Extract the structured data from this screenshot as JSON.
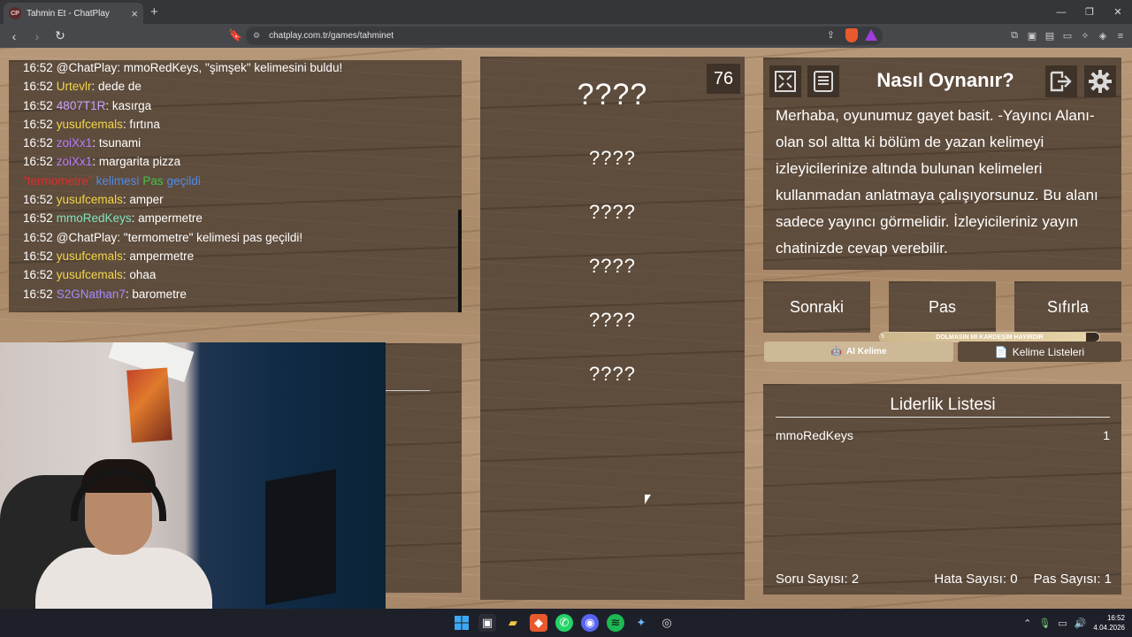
{
  "browser": {
    "tab_title": "Tahmin Et - ChatPlay",
    "tab_favicon_text": "CP",
    "url": "chatplay.com.tr/games/tahminet"
  },
  "chat": {
    "messages": [
      {
        "time": "16:52",
        "user": "@ChatPlay",
        "user_color": "#ffffff",
        "text": ": mmoRedKeys, \"şimşek\" kelimesini buldu!"
      },
      {
        "time": "16:52",
        "user": "Urtevlr",
        "user_color": "#f2d54b",
        "text": ": dede de"
      },
      {
        "time": "16:52",
        "user": "4807T1R",
        "user_color": "#c9a3ff",
        "text": ": kasırga"
      },
      {
        "time": "16:52",
        "user": "yusufcemals",
        "user_color": "#f2d54b",
        "text": ": fırtına"
      },
      {
        "time": "16:52",
        "user": "zoiXx1",
        "user_color": "#b77cff",
        "text": ": tsunami"
      },
      {
        "time": "16:52",
        "user": "zoiXx1",
        "user_color": "#b77cff",
        "text": ": margarita pizza"
      },
      {
        "time": "",
        "user": "",
        "user_color": "#ffffff",
        "text": "",
        "system": true
      },
      {
        "time": "16:52",
        "user": "yusufcemals",
        "user_color": "#f2d54b",
        "text": ": amper"
      },
      {
        "time": "16:52",
        "user": "mmoRedKeys",
        "user_color": "#7fe3c0",
        "text": ": ampermetre"
      },
      {
        "time": "16:52",
        "user": "@ChatPlay",
        "user_color": "#ffffff",
        "text": ": \"termometre\" kelimesi pas geçildi!"
      },
      {
        "time": "16:52",
        "user": "yusufcemals",
        "user_color": "#f2d54b",
        "text": ": ampermetre"
      },
      {
        "time": "16:52",
        "user": "yusufcemals",
        "user_color": "#f2d54b",
        "text": ": ohaa"
      },
      {
        "time": "16:52",
        "user": "S2GNathan7",
        "user_color": "#a48bff",
        "text": ": barometre"
      }
    ],
    "system_line": {
      "word": "\"termometre\"",
      "word_color": "#d8322e",
      "kelimesi": "kelimesi",
      "kelimesi_color": "#4f8be8",
      "pas": "Pas",
      "pas_color": "#45c24a",
      "gecildi": "geçildi",
      "gecildi_color": "#4f8be8"
    }
  },
  "game": {
    "timer": "76",
    "main_word": "????",
    "taboo_words": [
      "????",
      "????",
      "????",
      "????",
      "????"
    ]
  },
  "howto": {
    "title": "Nasıl Oynanır?",
    "text": "Merhaba, oyunumuz gayet basit. -Yayıncı Alanı- olan sol altta ki bölüm de yazan kelimeyi izleyicilerinize altında bulunan kelimeleri kullanmadan anlatmaya çalışıyorsunuz. Bu alanı sadece yayıncı görmelidir. İzleyicileriniz yayın chatinizde cevap verebilir.",
    "icons": [
      "fullscreen-icon",
      "document-icon",
      "exit-icon",
      "gear-icon"
    ]
  },
  "controls": {
    "next": "Sonraki",
    "pass": "Pas",
    "reset": "Sıfırla"
  },
  "progress": {
    "min": "5",
    "max": "10",
    "label": "DOLMASIN MI KARDEŞİM HAYIRDIR",
    "fraction": 0.94
  },
  "modes": {
    "ai": "AI Kelime",
    "lists": "Kelime Listeleri"
  },
  "leaderboard": {
    "title": "Liderlik Listesi",
    "entries": [
      {
        "name": "mmoRedKeys",
        "score": "1"
      }
    ]
  },
  "stats": {
    "questions": "Soru Sayısı: 2",
    "errors": "Hata Sayısı: 0",
    "passes": "Pas Sayısı: 1"
  },
  "taskbar": {
    "time": "16:52",
    "date": "4.04.2026"
  },
  "colors": {
    "panel": "#5e4c3c",
    "wood": "#b39473",
    "accent_mode": "#cdb897"
  }
}
